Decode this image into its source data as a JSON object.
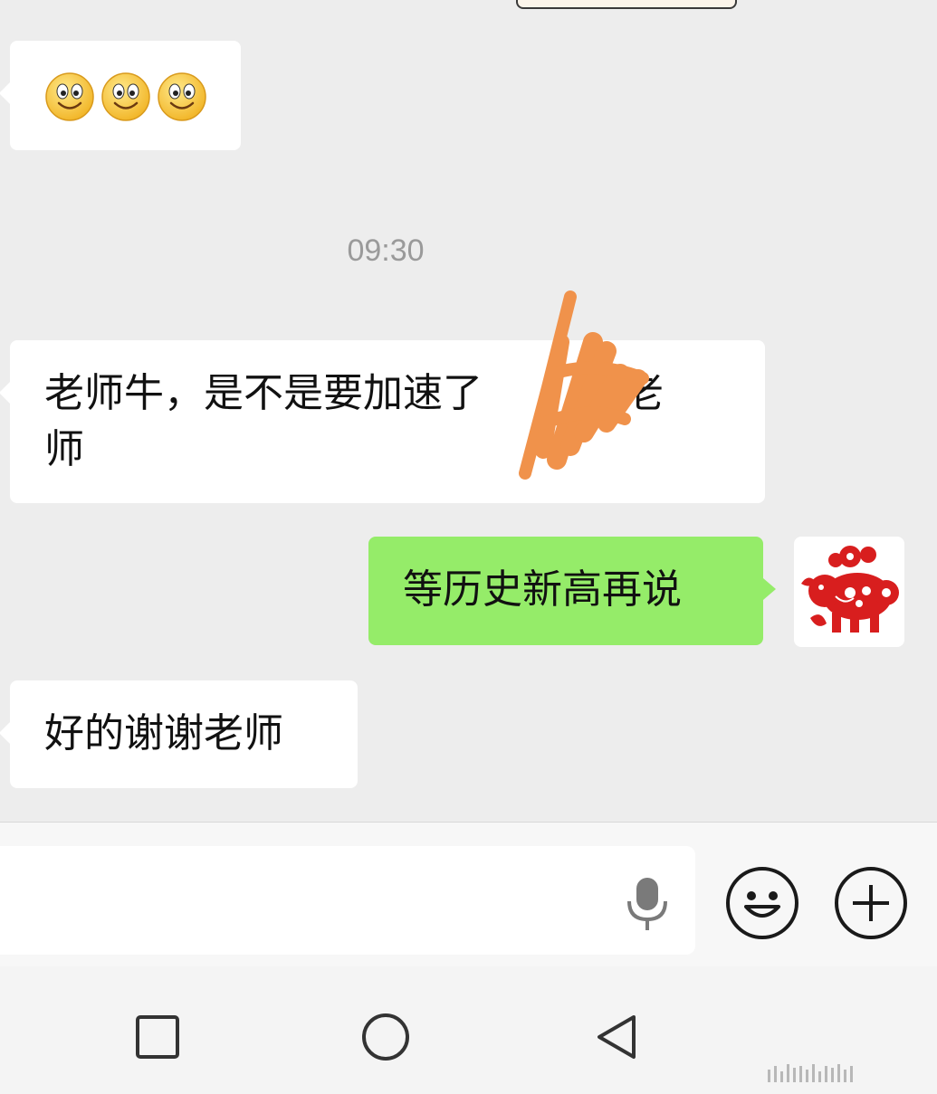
{
  "chat": {
    "messages": [
      {
        "side": "left",
        "type": "emoji",
        "emoji": [
          "smiley-icon",
          "smiley-icon",
          "smiley-icon"
        ]
      },
      {
        "type": "timestamp",
        "text": "09:30"
      },
      {
        "side": "left",
        "type": "text",
        "text": "老师牛，是不是要加速了        、老\n师",
        "redacted": true
      },
      {
        "side": "right",
        "type": "text",
        "text": "等历史新高再说",
        "avatar": "paper-cut-pig-avatar"
      },
      {
        "side": "left",
        "type": "text",
        "text": "好的谢谢老师"
      }
    ]
  },
  "input_bar": {
    "value": "",
    "icons": [
      "microphone-icon",
      "emoji-icon",
      "plus-icon"
    ]
  },
  "nav_bar": {
    "icons": [
      "recent-apps-icon",
      "home-icon",
      "back-icon"
    ]
  },
  "colors": {
    "background": "#ededed",
    "incoming_bubble": "#ffffff",
    "outgoing_bubble": "#95ec69",
    "redaction_scribble": "#f0924b",
    "avatar_red": "#d81e1e"
  }
}
